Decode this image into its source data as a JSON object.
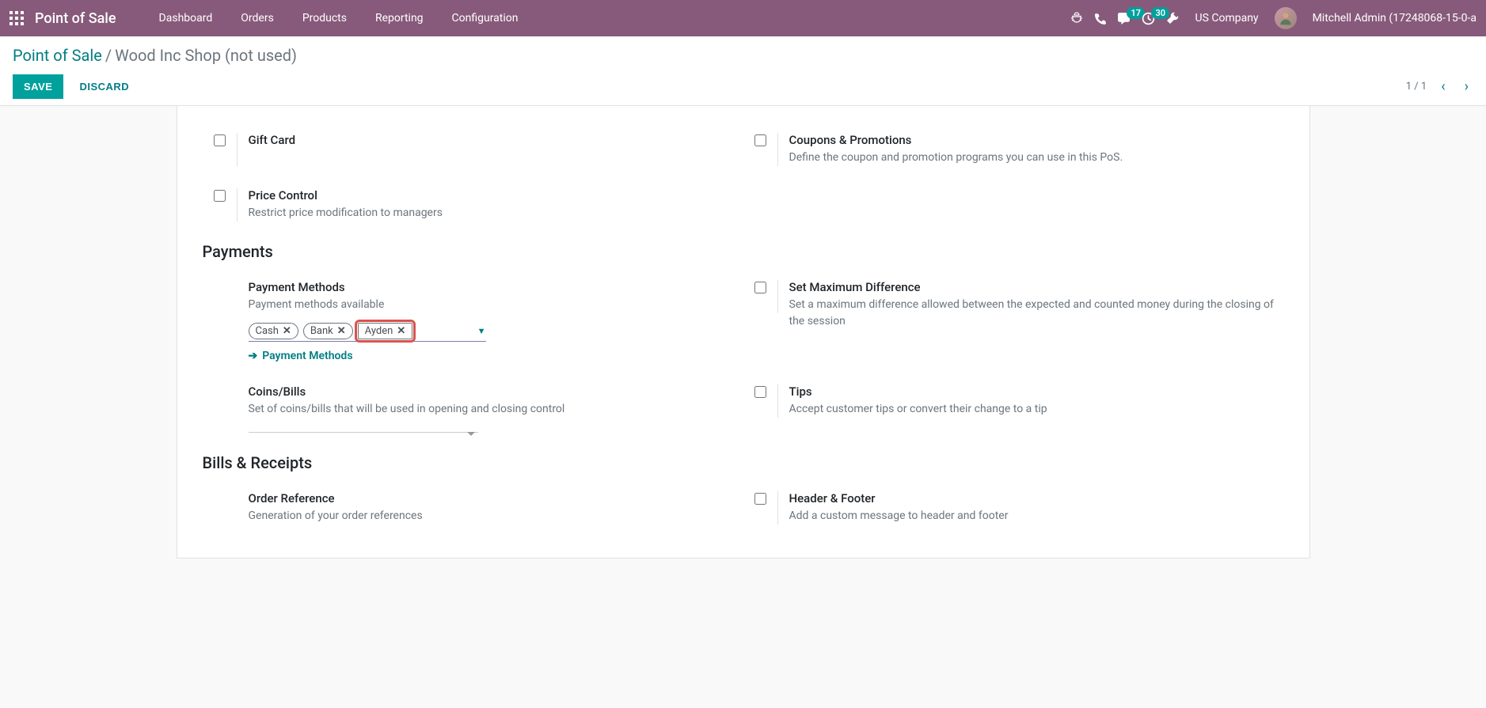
{
  "topnav": {
    "brand": "Point of Sale",
    "menu": [
      "Dashboard",
      "Orders",
      "Products",
      "Reporting",
      "Configuration"
    ],
    "chat_badge": "17",
    "clock_badge": "30",
    "company": "US Company",
    "user": "Mitchell Admin (17248068-15-0-a"
  },
  "breadcrumbs": {
    "root": "Point of Sale",
    "current": "Wood Inc Shop (not used)"
  },
  "buttons": {
    "save": "SAVE",
    "discard": "DISCARD"
  },
  "pager": {
    "text": "1 / 1"
  },
  "settings": {
    "gift_card": {
      "title": "Gift Card"
    },
    "coupons": {
      "title": "Coupons & Promotions",
      "desc": "Define the coupon and promotion programs you can use in this PoS."
    },
    "price_control": {
      "title": "Price Control",
      "desc": "Restrict price modification to managers"
    },
    "payments_heading": "Payments",
    "payment_methods": {
      "title": "Payment Methods",
      "desc": "Payment methods available",
      "tags": [
        "Cash",
        "Bank",
        "Ayden"
      ],
      "link": "Payment Methods"
    },
    "max_diff": {
      "title": "Set Maximum Difference",
      "desc": "Set a maximum difference allowed between the expected and counted money during the closing of the session"
    },
    "coins_bills": {
      "title": "Coins/Bills",
      "desc": "Set of coins/bills that will be used in opening and closing control"
    },
    "tips": {
      "title": "Tips",
      "desc": "Accept customer tips or convert their change to a tip"
    },
    "bills_heading": "Bills & Receipts",
    "order_ref": {
      "title": "Order Reference",
      "desc": "Generation of your order references"
    },
    "header_footer": {
      "title": "Header & Footer",
      "desc": "Add a custom message to header and footer"
    }
  }
}
